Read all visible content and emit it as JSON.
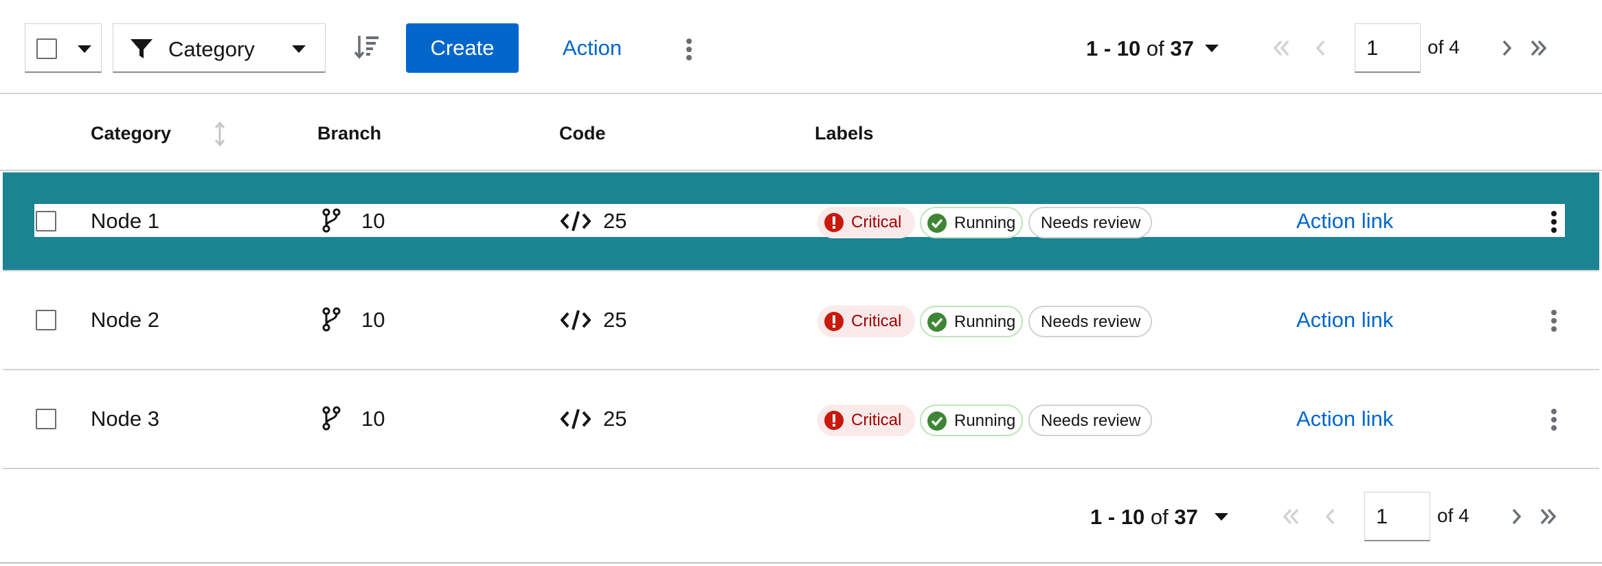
{
  "toolbar": {
    "filter_label": "Category",
    "create_label": "Create",
    "action_label": "Action",
    "pagination": {
      "range_start": "1",
      "range_sep": " - ",
      "range_end": "10",
      "of": " of ",
      "total": "37",
      "page": "1",
      "of_pages": "of 4"
    }
  },
  "columns": {
    "category": "Category",
    "branch": "Branch",
    "code": "Code",
    "labels": "Labels"
  },
  "rows": [
    {
      "name": "Node 1",
      "branches": "10",
      "code": "25",
      "label_critical": "Critical",
      "label_running": "Running",
      "label_review": "Needs review",
      "action": "Action link"
    },
    {
      "name": "Node 2",
      "branches": "10",
      "code": "25",
      "label_critical": "Critical",
      "label_running": "Running",
      "label_review": "Needs review",
      "action": "Action link"
    },
    {
      "name": "Node 3",
      "branches": "10",
      "code": "25",
      "label_critical": "Critical",
      "label_running": "Running",
      "label_review": "Needs review",
      "action": "Action link"
    }
  ],
  "footer": {
    "pagination": {
      "range_start": "1",
      "range_sep": " - ",
      "range_end": "10",
      "of": " of ",
      "total": "37",
      "page": "1",
      "of_pages": "of 4"
    }
  },
  "colors": {
    "accent": "#0066cc",
    "selected_row": "#1c8393",
    "critical": "#c9190b",
    "running": "#3e8635"
  }
}
